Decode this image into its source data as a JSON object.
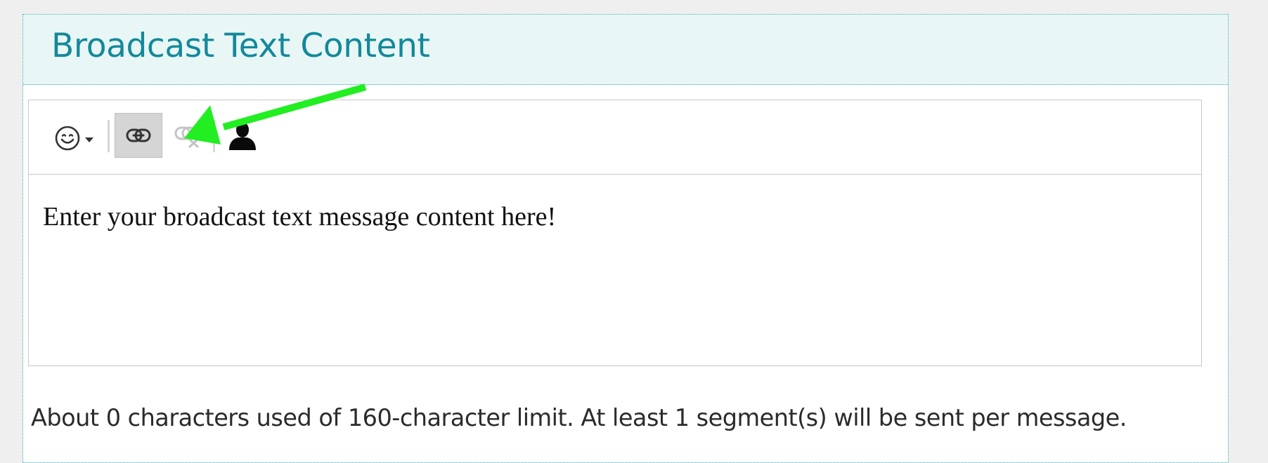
{
  "panel": {
    "title": "Broadcast Text Content"
  },
  "toolbar": {
    "emoji_icon": "smiley-face-icon",
    "link_icon": "link-icon",
    "unlink_icon": "unlink-icon",
    "contact_icon": "person-silhouette-icon"
  },
  "editor": {
    "content": "Enter your broadcast text message content here!"
  },
  "footer": {
    "char_count_text": "About 0 characters used of 160-character limit. At least 1 segment(s) will be sent per message."
  },
  "colors": {
    "title": "#13899a",
    "header_bg": "#e8f7f6",
    "border_dotted": "#27a6b0",
    "annotation_arrow": "#22ee22"
  }
}
